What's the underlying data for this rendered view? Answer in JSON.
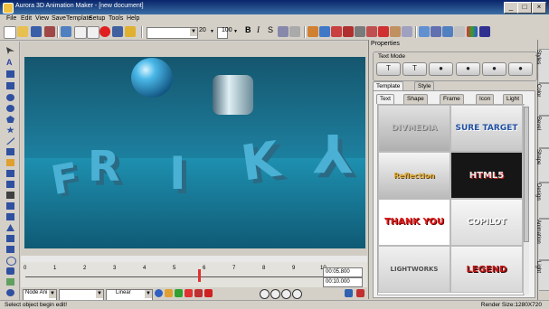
{
  "window": {
    "title": "Aurora 3D Animation Maker - [new document]",
    "controls": [
      "_",
      "□",
      "×"
    ]
  },
  "menu": [
    "File",
    "Edit",
    "View",
    "SaveTemplate",
    "Setup",
    "Tools",
    "Help"
  ],
  "toolbar": {
    "font_size": "20",
    "zoom_value": "100",
    "text_style_buttons": [
      "B",
      "I",
      "S"
    ]
  },
  "properties": {
    "header": "Properties",
    "text_mode_label": "Text Mode",
    "tabs_top": [
      "Template",
      "Style"
    ],
    "tabs_sub": [
      "Text",
      "Shape",
      "Frame",
      "Icon",
      "Light"
    ],
    "templates": [
      "DIVMEDIA",
      "SURE TARGET",
      "Reflection",
      "HTML5",
      "THANK YOU",
      "COPILOT",
      "LIGHTWORKS",
      "LEGEND"
    ],
    "side_tabs": [
      "Styles",
      "Color",
      "Bevel",
      "Shape",
      "Design",
      "Animation",
      "Light"
    ]
  },
  "scene": {
    "letters": [
      "F",
      "R",
      "I",
      "K",
      "Y"
    ]
  },
  "timeline": {
    "marks": [
      "0",
      "1",
      "2",
      "3",
      "4",
      "5",
      "6",
      "7",
      "8",
      "9",
      "10"
    ],
    "current_time": "00:05.800",
    "total_time": "00:10.000"
  },
  "bottom": {
    "node_select": "Node Ani",
    "interpolation": "Linear"
  },
  "status": {
    "left": "Select object begin edit!",
    "right": "Render Size:1280X720"
  },
  "colors": {
    "scene_blue": "#1a86a6",
    "titlebar": "#0a246a"
  }
}
